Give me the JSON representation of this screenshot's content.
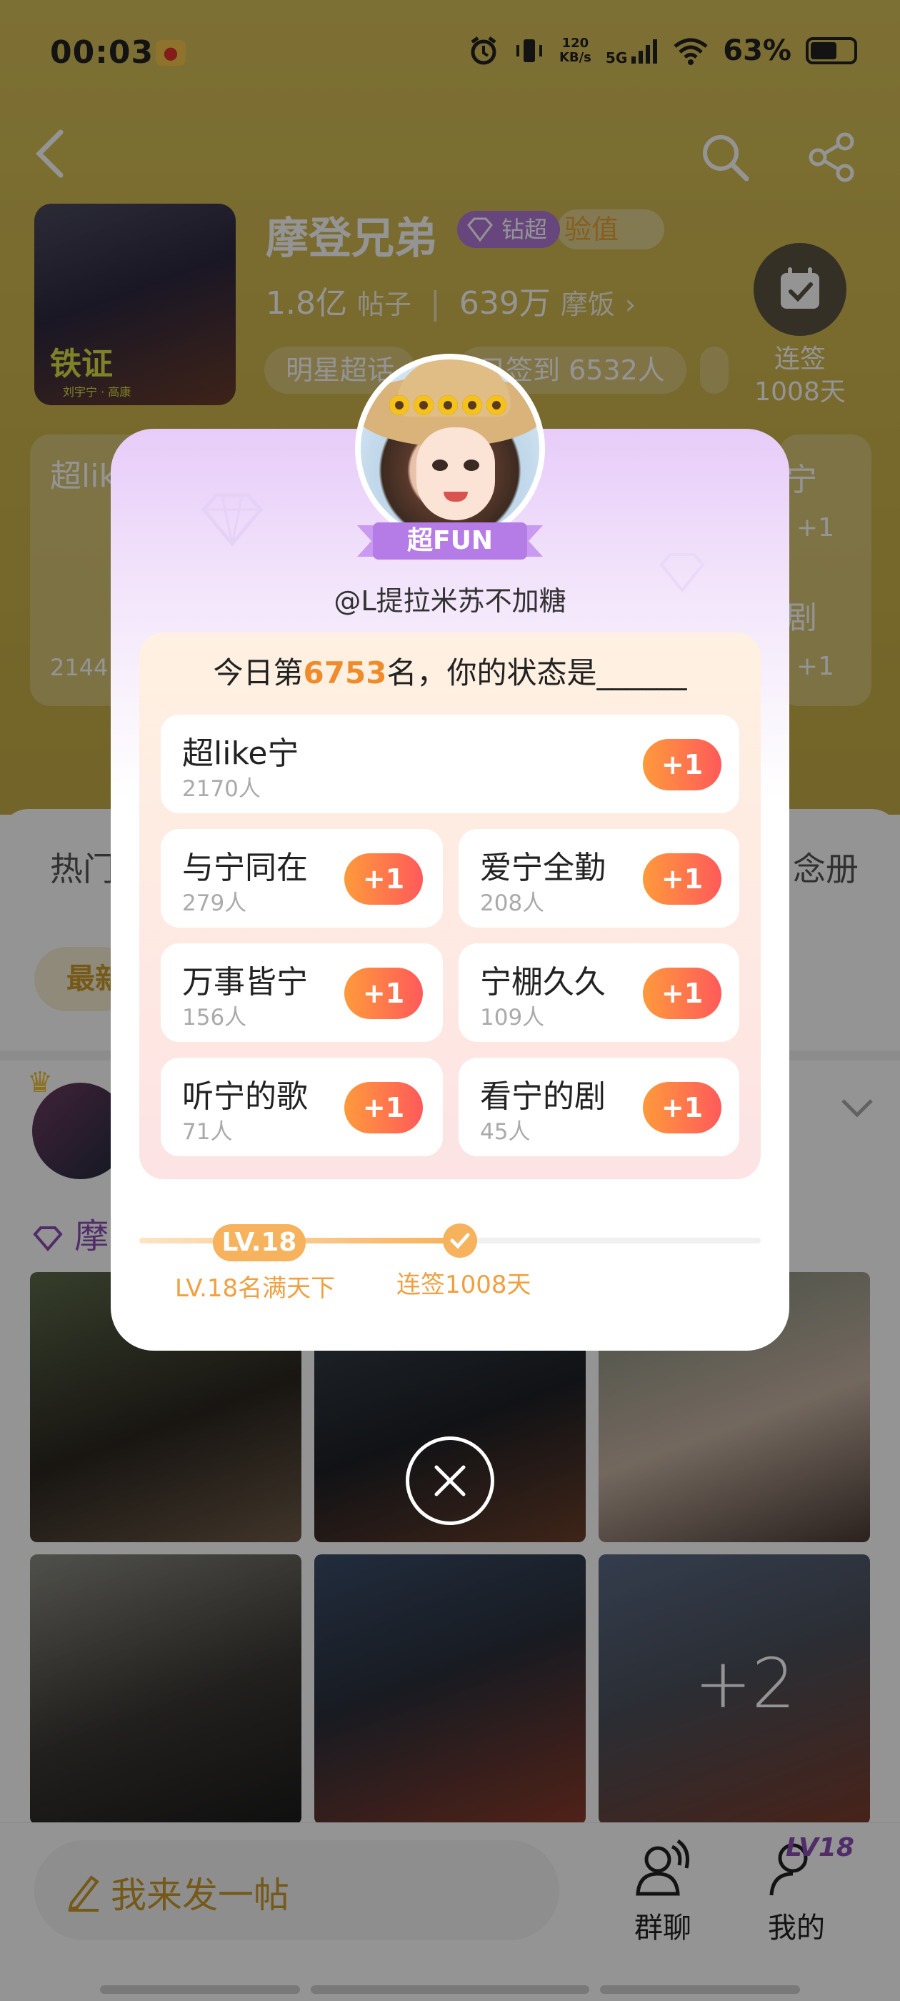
{
  "status_bar": {
    "time": "00:03",
    "speed_value": "120",
    "speed_unit": "KB/s",
    "network": "5G",
    "battery": "63%"
  },
  "topic": {
    "title": "摩登兄弟",
    "badge": "钻超",
    "exp_label": "验值",
    "posts_value": "1.8亿",
    "posts_label": "帖子",
    "fans_value": "639万",
    "fans_label": "摩饭",
    "tag1": "明星超话",
    "tag2": "日签到 6532人",
    "cover_title": "铁证",
    "cover_sub": "刘宇宁 · 高康"
  },
  "signin": {
    "label_line1": "连签",
    "label_line2": "1008天"
  },
  "bg_cards": {
    "left_title": "超lik",
    "left_count": "2144",
    "right_title1": "宁",
    "right_title2": "剧",
    "plus": "+1"
  },
  "bg_tabs": {
    "left": "热门",
    "right": "念册",
    "chip": "最新"
  },
  "post": {
    "text": "摩"
  },
  "photo_more": "+2",
  "bottom": {
    "compose": "我来发一帖",
    "group_chat": "群聊",
    "mine": "我的",
    "level": "LV18"
  },
  "modal": {
    "fun_badge": "超FUN",
    "username": "@L提拉米苏不加糖",
    "rank_prefix": "今日第",
    "rank_number": "6753",
    "rank_suffix": "名，你的状态是______",
    "plus_label": "+1",
    "options": [
      {
        "name": "超like宁",
        "count": "2170人"
      },
      {
        "name": "与宁同在",
        "count": "279人"
      },
      {
        "name": "爱宁全勤",
        "count": "208人"
      },
      {
        "name": "万事皆宁",
        "count": "156人"
      },
      {
        "name": "宁棚久久",
        "count": "109人"
      },
      {
        "name": "听宁的歌",
        "count": "71人"
      },
      {
        "name": "看宁的剧",
        "count": "45人"
      }
    ],
    "level_pill": "LV.18",
    "level_caption": "LV.18名满天下",
    "streak_caption": "连签1008天"
  },
  "colors": {
    "header_gold": "#cdb44a",
    "accent_orange": "#f08b2c",
    "plus_gradient_start": "#ff9a3c",
    "plus_gradient_end": "#ff5a5a",
    "level_gold": "#f6b25c",
    "purple": "#b079d8"
  }
}
